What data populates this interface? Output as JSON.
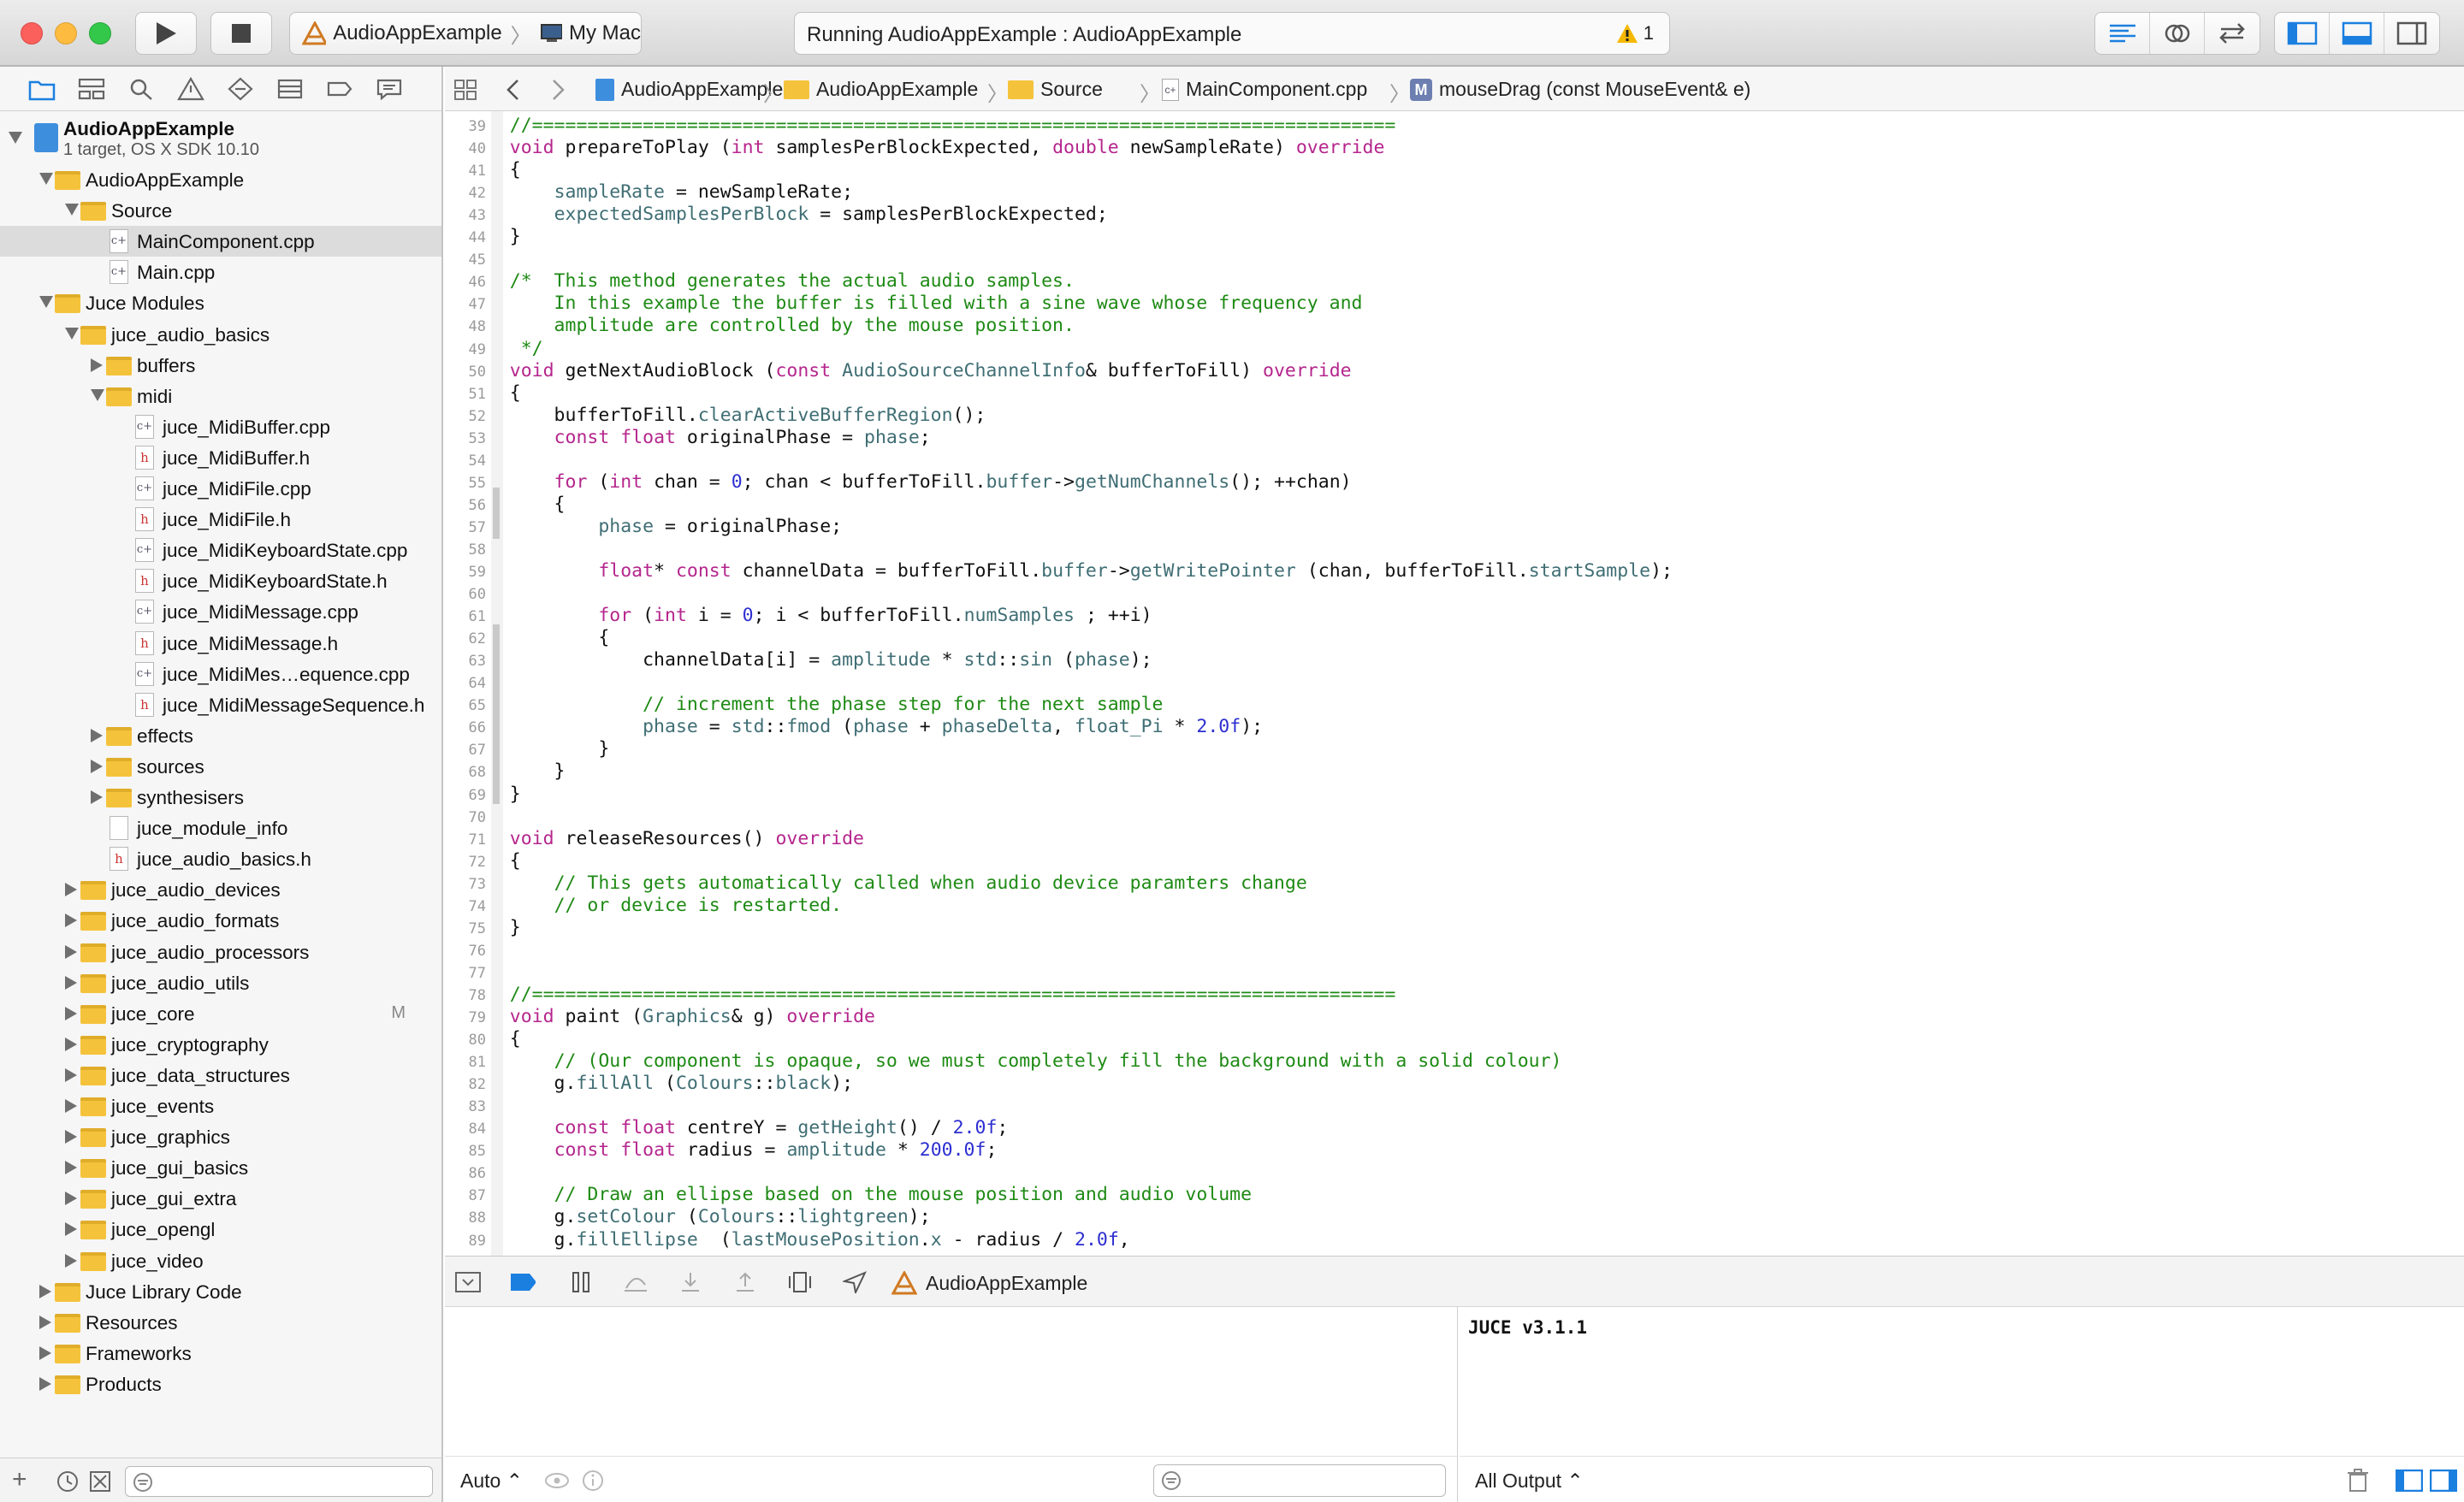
{
  "toolbar": {
    "scheme_name": "AudioAppExample",
    "destination": "My Mac",
    "activity_text": "Running AudioAppExample : AudioAppExample",
    "warning_count": "1"
  },
  "navigator": {
    "project": {
      "name": "AudioAppExample",
      "subtitle": "1 target, OS X SDK 10.10"
    },
    "tree": [
      {
        "label": "AudioAppExample",
        "indent": 1,
        "type": "folder",
        "expanded": true
      },
      {
        "label": "Source",
        "indent": 2,
        "type": "folder",
        "expanded": true
      },
      {
        "label": "MainComponent.cpp",
        "indent": 3,
        "type": "cpp",
        "selected": true
      },
      {
        "label": "Main.cpp",
        "indent": 3,
        "type": "cpp"
      },
      {
        "label": "Juce Modules",
        "indent": 1,
        "type": "folder",
        "expanded": true
      },
      {
        "label": "juce_audio_basics",
        "indent": 2,
        "type": "folder",
        "expanded": true
      },
      {
        "label": "buffers",
        "indent": 3,
        "type": "folder",
        "expanded": false
      },
      {
        "label": "midi",
        "indent": 3,
        "type": "folder",
        "expanded": true
      },
      {
        "label": "juce_MidiBuffer.cpp",
        "indent": 4,
        "type": "cpp"
      },
      {
        "label": "juce_MidiBuffer.h",
        "indent": 4,
        "type": "h"
      },
      {
        "label": "juce_MidiFile.cpp",
        "indent": 4,
        "type": "cpp"
      },
      {
        "label": "juce_MidiFile.h",
        "indent": 4,
        "type": "h"
      },
      {
        "label": "juce_MidiKeyboardState.cpp",
        "indent": 4,
        "type": "cpp"
      },
      {
        "label": "juce_MidiKeyboardState.h",
        "indent": 4,
        "type": "h"
      },
      {
        "label": "juce_MidiMessage.cpp",
        "indent": 4,
        "type": "cpp"
      },
      {
        "label": "juce_MidiMessage.h",
        "indent": 4,
        "type": "h"
      },
      {
        "label": "juce_MidiMes…equence.cpp",
        "indent": 4,
        "type": "cpp"
      },
      {
        "label": "juce_MidiMessageSequence.h",
        "indent": 4,
        "type": "h"
      },
      {
        "label": "effects",
        "indent": 3,
        "type": "folder",
        "expanded": false
      },
      {
        "label": "sources",
        "indent": 3,
        "type": "folder",
        "expanded": false
      },
      {
        "label": "synthesisers",
        "indent": 3,
        "type": "folder",
        "expanded": false
      },
      {
        "label": "juce_module_info",
        "indent": 3,
        "type": "plain"
      },
      {
        "label": "juce_audio_basics.h",
        "indent": 3,
        "type": "h"
      },
      {
        "label": "juce_audio_devices",
        "indent": 2,
        "type": "folder",
        "expanded": false
      },
      {
        "label": "juce_audio_formats",
        "indent": 2,
        "type": "folder",
        "expanded": false
      },
      {
        "label": "juce_audio_processors",
        "indent": 2,
        "type": "folder",
        "expanded": false
      },
      {
        "label": "juce_audio_utils",
        "indent": 2,
        "type": "folder",
        "expanded": false
      },
      {
        "label": "juce_core",
        "indent": 2,
        "type": "folder",
        "expanded": false,
        "badge": "M"
      },
      {
        "label": "juce_cryptography",
        "indent": 2,
        "type": "folder",
        "expanded": false
      },
      {
        "label": "juce_data_structures",
        "indent": 2,
        "type": "folder",
        "expanded": false
      },
      {
        "label": "juce_events",
        "indent": 2,
        "type": "folder",
        "expanded": false
      },
      {
        "label": "juce_graphics",
        "indent": 2,
        "type": "folder",
        "expanded": false
      },
      {
        "label": "juce_gui_basics",
        "indent": 2,
        "type": "folder",
        "expanded": false
      },
      {
        "label": "juce_gui_extra",
        "indent": 2,
        "type": "folder",
        "expanded": false
      },
      {
        "label": "juce_opengl",
        "indent": 2,
        "type": "folder",
        "expanded": false
      },
      {
        "label": "juce_video",
        "indent": 2,
        "type": "folder",
        "expanded": false
      },
      {
        "label": "Juce Library Code",
        "indent": 1,
        "type": "folder",
        "expanded": false
      },
      {
        "label": "Resources",
        "indent": 1,
        "type": "folder",
        "expanded": false
      },
      {
        "label": "Frameworks",
        "indent": 1,
        "type": "folder",
        "expanded": false
      },
      {
        "label": "Products",
        "indent": 1,
        "type": "folder",
        "expanded": false
      }
    ]
  },
  "jumpbar": {
    "crumbs": [
      "AudioAppExample",
      "AudioAppExample",
      "Source",
      "MainComponent.cpp",
      "mouseDrag (const MouseEvent& e)"
    ]
  },
  "editor": {
    "first_line": 39,
    "lines": [
      "    //==============================================================================",
      "    void prepareToPlay (int samplesPerBlockExpected, double newSampleRate) override",
      "    {",
      "        sampleRate = newSampleRate;",
      "        expectedSamplesPerBlock = samplesPerBlockExpected;",
      "    }",
      "",
      "    /*  This method generates the actual audio samples.",
      "        In this example the buffer is filled with a sine wave whose frequency and",
      "        amplitude are controlled by the mouse position.",
      "     */",
      "    void getNextAudioBlock (const AudioSourceChannelInfo& bufferToFill) override",
      "    {",
      "        bufferToFill.clearActiveBufferRegion();",
      "        const float originalPhase = phase;",
      "",
      "        for (int chan = 0; chan < bufferToFill.buffer->getNumChannels(); ++chan)",
      "        {",
      "            phase = originalPhase;",
      "",
      "            float* const channelData = bufferToFill.buffer->getWritePointer (chan, bufferToFill.startSample);",
      "",
      "            for (int i = 0; i < bufferToFill.numSamples ; ++i)",
      "            {",
      "                channelData[i] = amplitude * std::sin (phase);",
      "",
      "                // increment the phase step for the next sample",
      "                phase = std::fmod (phase + phaseDelta, float_Pi * 2.0f);",
      "            }",
      "        }",
      "    }",
      "",
      "    void releaseResources() override",
      "    {",
      "        // This gets automatically called when audio device paramters change",
      "        // or device is restarted.",
      "    }",
      "",
      "",
      "    //==============================================================================",
      "    void paint (Graphics& g) override",
      "    {",
      "        // (Our component is opaque, so we must completely fill the background with a solid colour)",
      "        g.fillAll (Colours::black);",
      "",
      "        const float centreY = getHeight() / 2.0f;",
      "        const float radius = amplitude * 200.0f;",
      "",
      "        // Draw an ellipse based on the mouse position and audio volume",
      "        g.setColour (Colours::lightgreen);",
      "        g.fillEllipse  (lastMousePosition.x - radius / 2.0f,"
    ]
  },
  "debugbar": {
    "target": "AudioAppExample"
  },
  "variables": {
    "scope": "Auto ⌃"
  },
  "console": {
    "text": "JUCE v3.1.1",
    "filter": "All Output ⌃"
  },
  "colors": {
    "keyword": "#b5268d",
    "type": "#3f6e74",
    "comment": "#1e8a14",
    "number": "#2d2fd0",
    "folder": "#f5c33b",
    "accent": "#1b7fe0"
  }
}
